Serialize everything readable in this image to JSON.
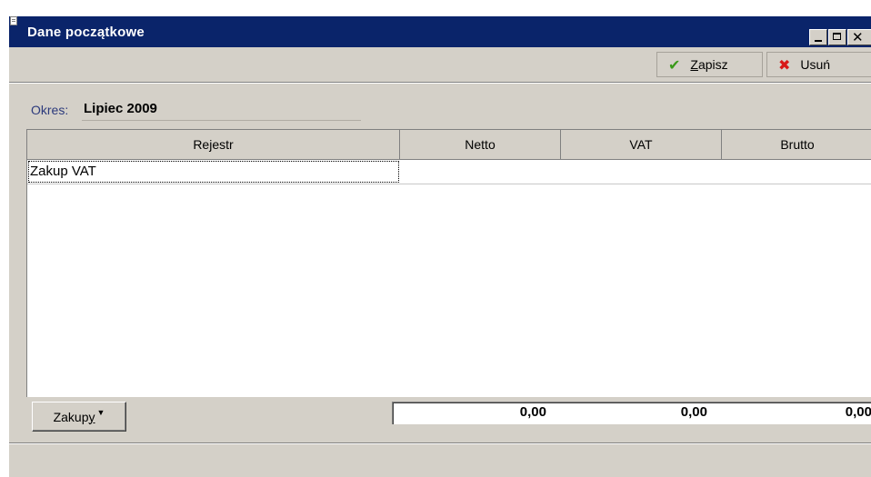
{
  "window": {
    "title": "Dane początkowe",
    "close_glyph": "✕"
  },
  "toolbar": {
    "save_label": "Zapisz",
    "save_accel": "Z",
    "save_rest": "apisz",
    "delete_label": "Usuń",
    "save_icon": "check-icon",
    "delete_icon": "cross-icon"
  },
  "period": {
    "label": "Okres:",
    "value": "Lipiec 2009"
  },
  "table": {
    "columns": [
      "Rejestr",
      "Netto",
      "VAT",
      "Brutto"
    ],
    "rows": [
      {
        "rejestr": "Zakup VAT",
        "netto": "",
        "vat": "",
        "brutto": ""
      }
    ]
  },
  "footer": {
    "type_button_label": "Zakupy",
    "type_button_text": "Zakup",
    "type_button_accel": "y",
    "totals": {
      "netto": "0,00",
      "vat": "0,00",
      "brutto": "0,00"
    }
  },
  "colors": {
    "titlebar": "#0a246a",
    "face": "#d4d0c8",
    "check": "#3a9a1a",
    "cross": "#d81818"
  }
}
